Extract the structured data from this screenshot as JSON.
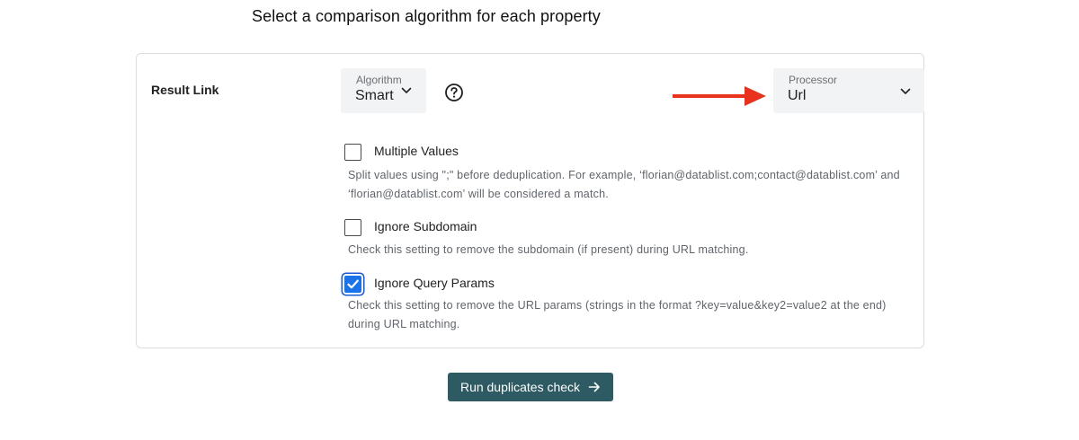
{
  "page": {
    "heading": "Select a comparison algorithm for each property"
  },
  "property": {
    "label": "Result Link",
    "algorithm": {
      "label": "Algorithm",
      "value": "Smart"
    },
    "help_icon": "help-circle-icon",
    "annotation_arrow_color": "#e8321e",
    "processor": {
      "label": "Processor",
      "value": "Url"
    },
    "options": [
      {
        "title": "Multiple Values",
        "checked": false,
        "description_line1": "Split values using \";\" before deduplication. For example, ‘florian@datablist.com;contact@datablist.com’ and",
        "description_line2": "‘florian@datablist.com’ will be considered a match."
      },
      {
        "title": "Ignore Subdomain",
        "checked": false,
        "description_line1": "Check this setting to remove the subdomain (if present) during URL matching."
      },
      {
        "title": "Ignore Query Params",
        "checked": true,
        "description_line1": "Check this setting to remove the URL params (strings in the format ?key=value&key2=value2 at the end)",
        "description_line2": "during URL matching."
      }
    ]
  },
  "actions": {
    "run_label": "Run duplicates check",
    "run_icon": "arrow-right-icon",
    "run_color": "#2e5a63"
  }
}
